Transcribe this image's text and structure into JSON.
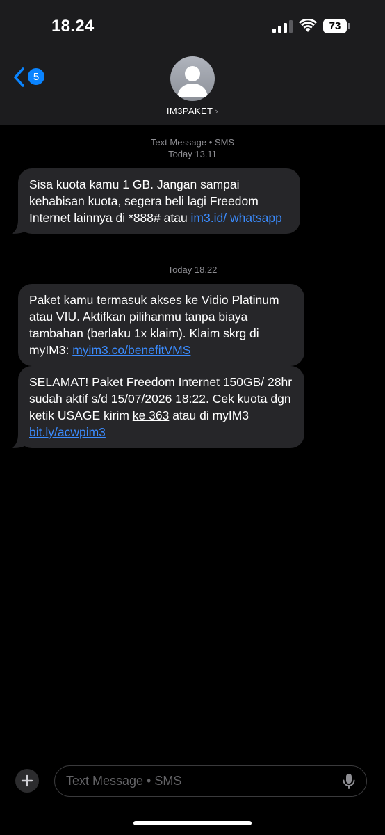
{
  "status_bar": {
    "time": "18.24",
    "battery": "73"
  },
  "header": {
    "back_badge": "5",
    "contact_name": "IM3PAKET",
    "contact_chevron": "›"
  },
  "conversation": {
    "meta_1_type": "Text Message • SMS",
    "meta_1_time": "Today 13.11",
    "meta_2_time": "Today 18.22",
    "messages": [
      {
        "text": "Sisa kuota kamu 1 GB. Jangan sampai kehabisan kuota, segera beli lagi Freedom Internet lainnya di *888# atau ",
        "link": "im3.id/ whatsapp"
      },
      {
        "text": "Paket kamu termasuk akses ke Vidio Platinum atau VIU. Aktifkan pilihanmu tanpa biaya tambahan (berlaku 1x klaim). Klaim skrg di myIM3: ",
        "link": "myim3.co/benefitVMS"
      },
      {
        "text_a": "SELAMAT! Paket Freedom Internet 150GB/ 28hr sudah aktif s/d ",
        "date": "15/07/2026 18:22",
        "text_b": ". Cek kuota dgn ketik USAGE kirim ",
        "number": "ke 363",
        "text_c": " atau di myIM3 ",
        "link": "bit.ly/acwpim3"
      }
    ]
  },
  "composer": {
    "placeholder": "Text Message • SMS"
  },
  "icons": {
    "back": "chevron-left-icon",
    "avatar": "person-icon",
    "add": "plus-icon",
    "mic": "microphone-icon",
    "signal": "cellular-signal-icon",
    "wifi": "wifi-icon",
    "battery": "battery-icon"
  },
  "colors": {
    "accent": "#0a84ff",
    "link": "#3b8cff",
    "bubble": "#262629",
    "header": "#1c1c1e"
  }
}
